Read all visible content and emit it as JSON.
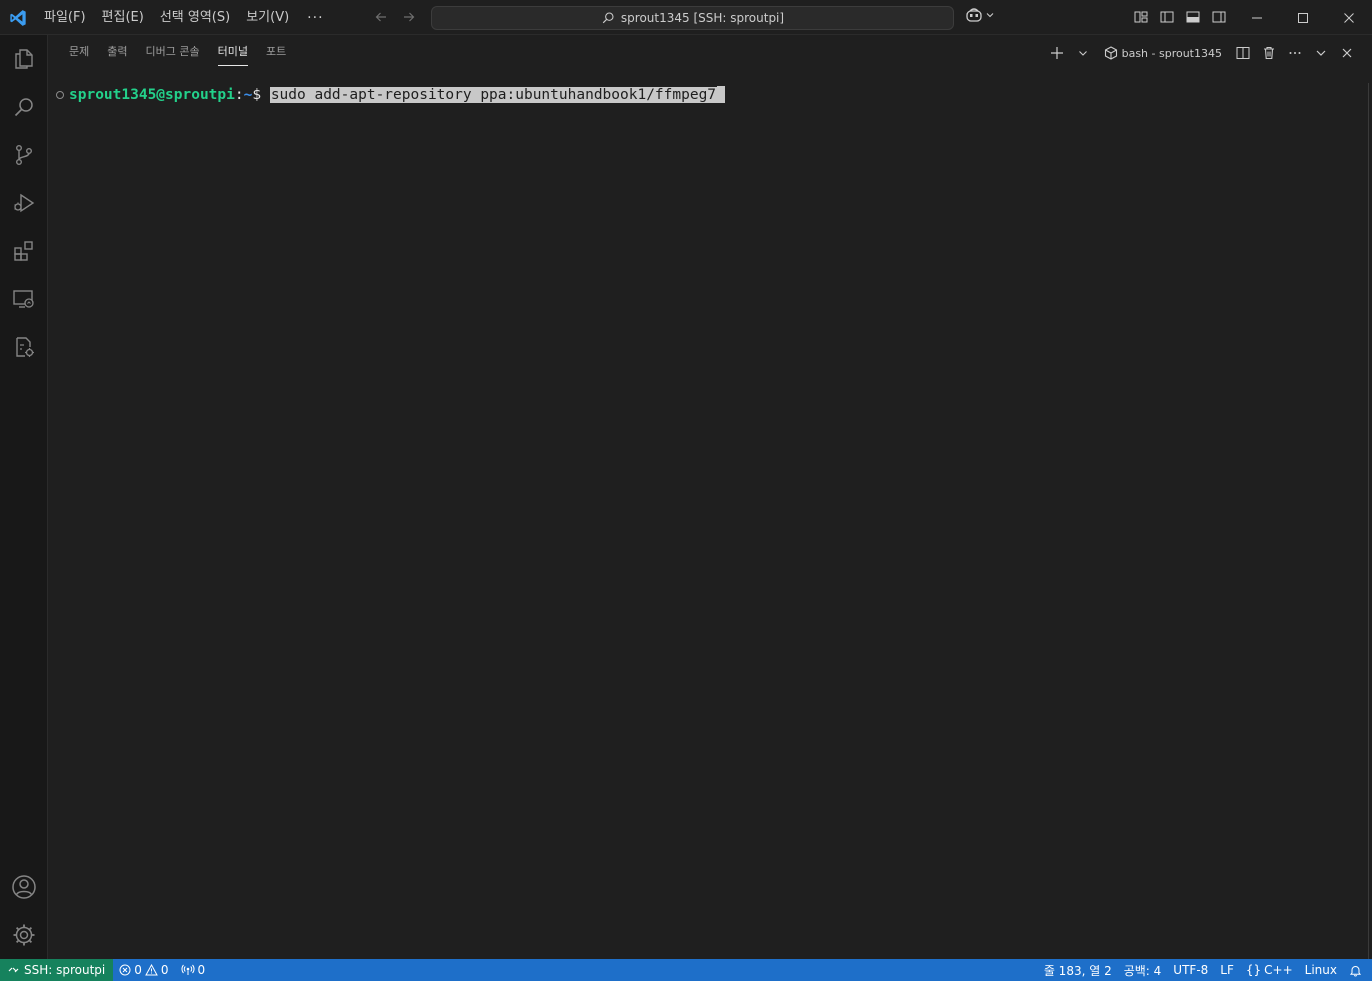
{
  "window": {
    "command_center": "sprout1345 [SSH: sproutpi]"
  },
  "menu": [
    {
      "label": "파일(F)"
    },
    {
      "label": "편집(E)"
    },
    {
      "label": "선택 영역(S)"
    },
    {
      "label": "보기(V)"
    },
    {
      "label": "···"
    }
  ],
  "panel": {
    "tabs": [
      {
        "label": "문제"
      },
      {
        "label": "출력"
      },
      {
        "label": "디버그 콘솔"
      },
      {
        "label": "터미널"
      },
      {
        "label": "포트"
      }
    ],
    "active_tab": "터미널",
    "terminal_name": "bash - sprout1345"
  },
  "terminal": {
    "user_host": "sprout1345@sproutpi",
    "colon": ":",
    "path": "~",
    "dollar": "$ ",
    "command": "sudo add-apt-repository ppa:ubuntuhandbook1/ffmpeg7"
  },
  "statusbar": {
    "remote": "SSH: sproutpi",
    "errors": "0",
    "warnings": "0",
    "ports": "0",
    "position": "줄 183, 열 2",
    "spaces": "공백: 4",
    "encoding": "UTF-8",
    "eol": "LF",
    "language": "C++",
    "os": "Linux"
  },
  "colors": {
    "accent": "#1e6fc9",
    "remote": "#16825d",
    "prompt_user": "#23d18b",
    "prompt_path": "#3b8eea"
  },
  "icons": {
    "activity": [
      "explorer-icon",
      "search-icon",
      "source-control-icon",
      "run-debug-icon",
      "extensions-icon",
      "remote-explorer-icon",
      "settings-sync-icon",
      "account-icon",
      "manage-gear-icon"
    ]
  }
}
